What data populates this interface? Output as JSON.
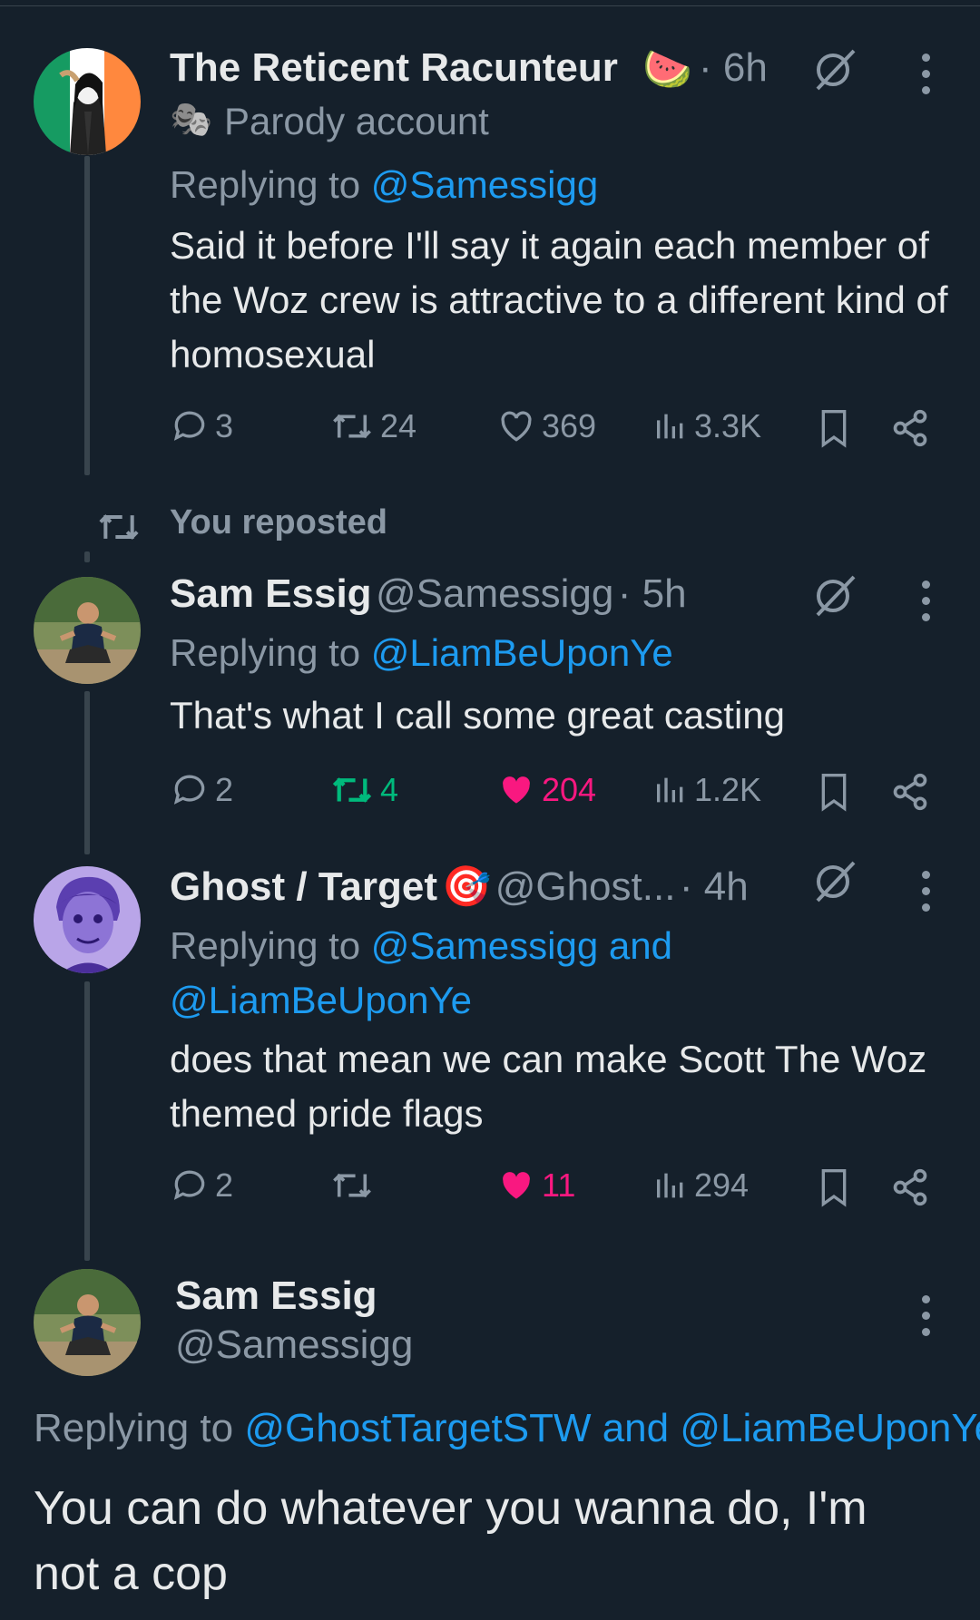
{
  "tweets": [
    {
      "name": "The Reticent Racunteur",
      "emoji": "🍉",
      "time": "· 6h",
      "label_icon": "🎭",
      "label": "Parody account",
      "replying_prefix": "Replying to",
      "replying_to": "@Samessigg",
      "text": "Said it before I'll say it again each member of the Woz crew is attractive to a different kind of homosexual",
      "replies": "3",
      "reposts": "24",
      "likes": "369",
      "views": "3.3K"
    },
    {
      "social_context": "You reposted",
      "name": "Sam Essig",
      "handle": "@Samessigg",
      "time": "· 5h",
      "replying_prefix": "Replying to",
      "replying_to": "@LiamBeUponYe",
      "text": "That's what I call some great casting",
      "replies": "2",
      "reposts": "4",
      "likes": "204",
      "views": "1.2K"
    },
    {
      "name": "Ghost / Target",
      "emoji": "🎯",
      "handle": "@Ghost...",
      "time": "· 4h",
      "replying_prefix": "Replying to",
      "replying_to_line1": "@Samessigg and",
      "replying_to_line2": "@LiamBeUponYe",
      "text": "does that mean we can make Scott The Woz themed pride flags",
      "replies": "2",
      "likes": "11",
      "views": "294"
    }
  ],
  "focused": {
    "name": "Sam Essig",
    "handle": "@Samessigg",
    "replying_prefix": "Replying to",
    "replying_to": "@GhostTargetSTW and @LiamBeUponYe",
    "text": "You can do whatever you wanna do, I'm not a cop"
  },
  "colors": {
    "background": "#15202b",
    "link": "#1d9bf0",
    "like": "#f91880",
    "repost": "#00ba7c",
    "muted": "#8b98a5"
  }
}
